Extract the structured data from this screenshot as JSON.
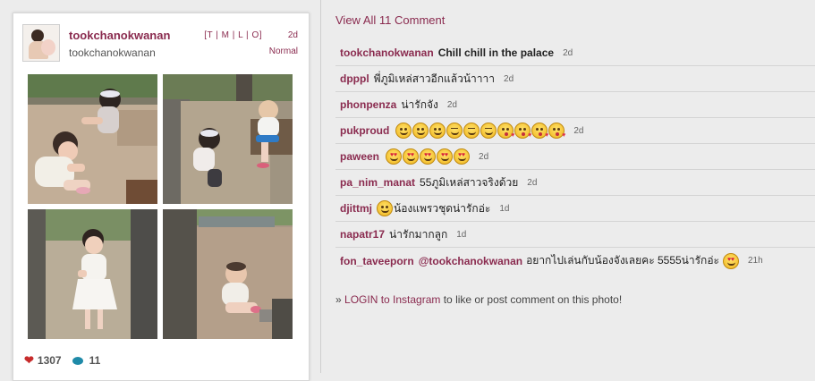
{
  "post": {
    "username": "tookchanokwanan",
    "full_name": "tookchanokwanan",
    "links": [
      "T",
      "M",
      "L",
      "O"
    ],
    "time": "2d",
    "filter": "Normal",
    "likes": "1307",
    "comments_count": "11"
  },
  "comments_header": "View All 11 Comment",
  "comments": [
    {
      "user": "tookchanokwanan",
      "text": "Chill chill in the palace",
      "time": "2d"
    },
    {
      "user": "dpppl",
      "text": "พี่ภูมิเหล่สาวอีกแล้วน้าาาา",
      "time": "2d"
    },
    {
      "user": "phonpenza",
      "text": "น่ารักจัง",
      "time": "2d"
    },
    {
      "user": "pukproud",
      "text": "",
      "time": "2d"
    },
    {
      "user": "paween",
      "text": "",
      "time": "2d"
    },
    {
      "user": "pa_nim_manat",
      "text": "55ภูมิเหล่สาวจริงด้วย",
      "time": "2d"
    },
    {
      "user": "djittmj",
      "text": "น้องแพรวชุดน่ารักอ่ะ",
      "time": "1d"
    },
    {
      "user": "napatr17",
      "text": "น่ารักมากลูก",
      "time": "1d"
    },
    {
      "user": "fon_taveeporn",
      "mention": "@tookchanokwanan",
      "text": "อยากไปเล่นกับน้องจังเลยคะ 5555น่ารักอ่ะ",
      "time": "21h"
    }
  ],
  "login": {
    "prefix": "» ",
    "link": "LOGIN to Instagram",
    "suffix": " to like or post comment on this photo!"
  },
  "colors": {
    "accent": "#8a2b4f",
    "background": "#ececec",
    "heart": "#c72c2c",
    "comment_icon": "#1f8aa8"
  }
}
